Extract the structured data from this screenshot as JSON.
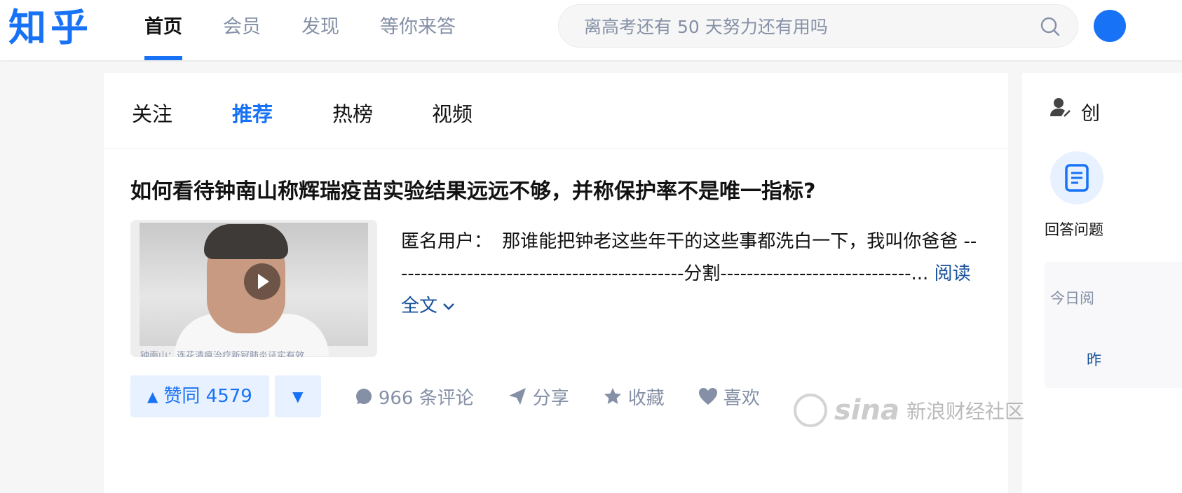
{
  "header": {
    "logo": "知乎",
    "nav": [
      "首页",
      "会员",
      "发现",
      "等你来答"
    ],
    "nav_active": 0,
    "search_placeholder": "离高考还有 50 天努力还有用吗"
  },
  "feed_tabs": [
    "关注",
    "推荐",
    "热榜",
    "视频"
  ],
  "feed_active": 1,
  "feed_item": {
    "title": "如何看待钟南山称辉瑞疫苗实验结果远远不够，并称保护率不是唯一指标?",
    "thumb_caption": "钟南山：连花清瘟治疗新冠肺炎证实有效",
    "author": "匿名用户：",
    "excerpt": "那谁能把钟老这些年干的这些事都洗白一下，我叫你爸爸 ---------------------------------------------分割-----------------------------...",
    "read_more": "阅读全文",
    "vote_up": "赞同 4579",
    "comments": "966 条评论",
    "share": "分享",
    "favorite": "收藏",
    "like": "喜欢"
  },
  "sidebar": {
    "creator_title": "创",
    "answer_label": "回答问题",
    "today_label": "今日阅",
    "yesterday_label": "昨"
  },
  "watermark": {
    "logo": "sina",
    "text": "新浪财经社区"
  },
  "colors": {
    "brand_blue": "#1772f6",
    "link_blue": "#175199",
    "muted_gray": "#8590a6"
  }
}
